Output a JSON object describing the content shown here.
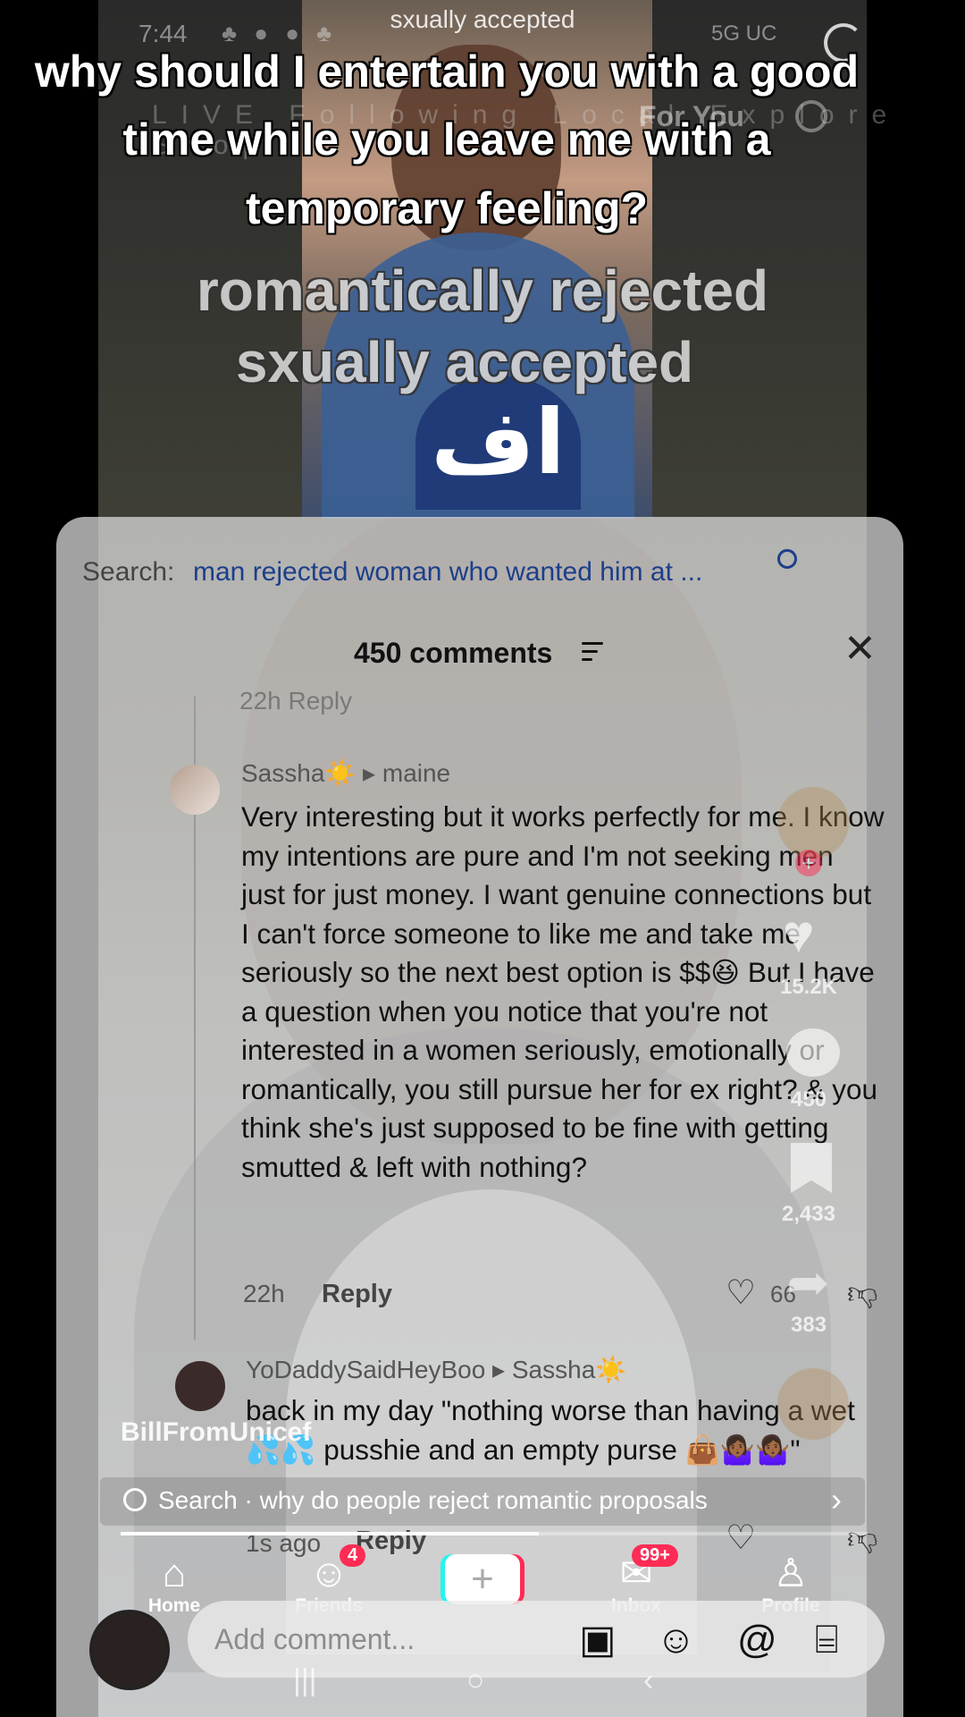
{
  "status_bar": {
    "time": "7:44",
    "icons": "♣ ● ● ♣",
    "network": "5G UC"
  },
  "mini_caption": "sxually accepted",
  "top_nav": {
    "tabs": "LIVE Following Local Explore Shop",
    "active_tab": "For You",
    "search_icon": "search-icon"
  },
  "captions": {
    "main": [
      "why should I entertain you with a good",
      "time while you leave me with a",
      "temporary feeling?"
    ],
    "overlay": [
      "romantically rejected",
      "sxually accepted"
    ]
  },
  "shirt_logo": "اف",
  "comments_panel": {
    "search_label": "Search:",
    "search_query": "man rejected woman who wanted him at ...",
    "count_label": "450 comments",
    "cutoff_row": "22h   Reply",
    "comments": [
      {
        "author": "Sassha☀️  ▸ maine",
        "text": "Very interesting but it works perfectly for me. I know my intentions are pure and I'm not seeking men just for just money. I want genuine connections but I can't force someone to like me and take me seriously so the next best option is $$😆 But I have a question when you notice that you're not interested in a women seriously, emotionally or romantically, you still pursue her for ex right? & you think she's just supposed to be fine with getting smutted & left with nothing?",
        "time": "22h",
        "reply": "Reply",
        "likes": "66"
      },
      {
        "author": "YoDaddySaidHeyBoo ▸ Sassha☀️",
        "text": "back in my day \"nothing worse than having a wet 💦💦 pusshie and an empty purse 👜🤷🏾‍♀️🤷🏾‍♀️\"",
        "time": "1s ago",
        "reply": "Reply"
      }
    ]
  },
  "action_rail": {
    "likes": "15.2K",
    "comments": "450",
    "saves": "2,433",
    "shares": "383"
  },
  "video_info": {
    "username": "BillFromUnicef"
  },
  "related_search": {
    "prefix": "Search ·",
    "query": "why do people reject romantic proposals",
    "progress": 0.56
  },
  "tabbar": {
    "home": "Home",
    "friends": "Friends",
    "friends_badge": "4",
    "create": "+",
    "inbox": "Inbox",
    "inbox_badge": "99+",
    "profile": "Profile"
  },
  "comment_input": {
    "placeholder": "Add comment..."
  },
  "colors": {
    "accent": "#fe2c55",
    "link": "#1c3f8a",
    "teal": "#25f4ee"
  }
}
